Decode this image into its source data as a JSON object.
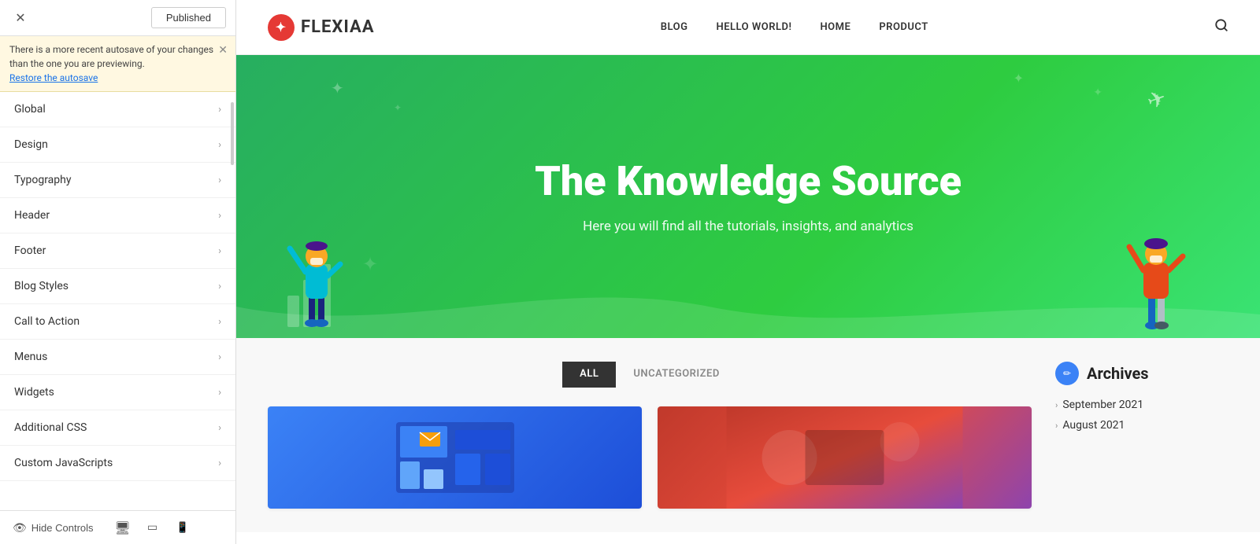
{
  "panel": {
    "close_label": "✕",
    "published_label": "Published",
    "autosave_message": "There is a more recent autosave of your changes than the one you are previewing.",
    "restore_link": "Restore the autosave",
    "close_notice_label": "✕",
    "menu_items": [
      {
        "id": "global",
        "label": "Global"
      },
      {
        "id": "design",
        "label": "Design"
      },
      {
        "id": "typography",
        "label": "Typography"
      },
      {
        "id": "header",
        "label": "Header"
      },
      {
        "id": "footer",
        "label": "Footer"
      },
      {
        "id": "blog-styles",
        "label": "Blog Styles"
      },
      {
        "id": "call-to-action",
        "label": "Call to Action"
      },
      {
        "id": "menus",
        "label": "Menus"
      },
      {
        "id": "widgets",
        "label": "Widgets"
      },
      {
        "id": "additional-css",
        "label": "Additional CSS"
      },
      {
        "id": "custom-javascripts",
        "label": "Custom JavaScripts"
      }
    ],
    "hide_controls_label": "Hide Controls",
    "footer": {
      "desktop_icon": "🖥",
      "tablet_icon": "⬛",
      "mobile_icon": "📱"
    }
  },
  "preview": {
    "nav": {
      "logo_text": "FLEXIAA",
      "logo_icon": "✦",
      "links": [
        "BLOG",
        "HELLO WORLD!",
        "HOME",
        "PRODUCT"
      ],
      "search_icon": "🔍"
    },
    "hero": {
      "title": "The Knowledge Source",
      "subtitle": "Here you will find all the tutorials, insights, and analytics"
    },
    "filter_tabs": [
      {
        "label": "ALL",
        "active": true
      },
      {
        "label": "UNCATEGORIZED",
        "active": false
      }
    ],
    "sidebar": {
      "title": "Archives",
      "edit_icon": "✏",
      "items": [
        {
          "label": "September 2021"
        },
        {
          "label": "August 2021"
        }
      ]
    }
  }
}
